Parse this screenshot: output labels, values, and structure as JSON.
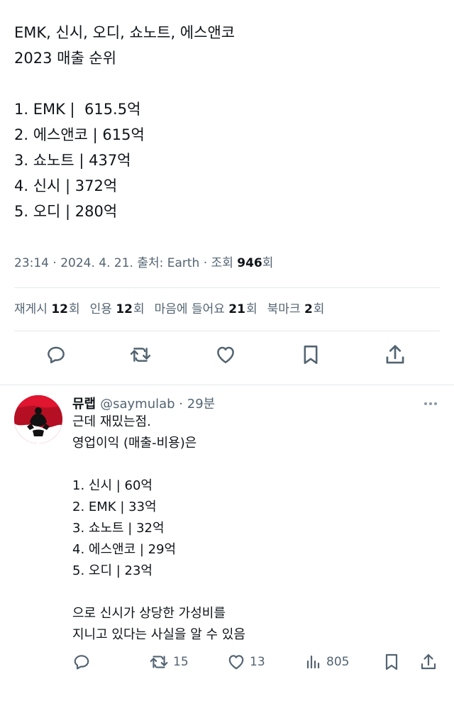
{
  "tweet": {
    "lines": [
      "EMK, 신시, 오디, 쇼노트, 에스앤코",
      "2023 매출 순위",
      "",
      "1. EMK |  615.5억",
      "2. 에스앤코 | 615억",
      "3. 쇼노트 | 437억",
      "4. 신시 | 372억",
      "5. 오디 | 280억"
    ],
    "meta_prefix": "23:14 · 2024. 4. 21. 출처: Earth · 조회 ",
    "views_count": "946",
    "views_suffix": "회",
    "stats": [
      {
        "label": "재게시",
        "count": "12",
        "suffix": "회"
      },
      {
        "label": "인용",
        "count": "12",
        "suffix": "회"
      },
      {
        "label": "마음에 들어요",
        "count": "21",
        "suffix": "회"
      },
      {
        "label": "북마크",
        "count": "2",
        "suffix": "회"
      }
    ],
    "actions": [
      {
        "icon": "reply-icon"
      },
      {
        "icon": "retweet-icon"
      },
      {
        "icon": "heart-icon"
      },
      {
        "icon": "bookmark-icon"
      },
      {
        "icon": "share-icon"
      }
    ]
  },
  "reply": {
    "name": "뮤랩",
    "handle": "@saymulab · 29분",
    "lines": [
      "근데 재밌는점.",
      "영업이익 (매출-비용)은",
      "",
      "1. 신시 | 60억",
      "2. EMK | 33억",
      "3. 쇼노트 | 32억",
      "4. 에스앤코 | 29억",
      "5. 오디 | 23억",
      "",
      "으로 신시가 상당한 가성비를",
      "지니고 있다는 사실을 알 수 있음"
    ],
    "retweets": "15",
    "likes": "13",
    "views": "805"
  },
  "colors": {
    "text": "#0f1419",
    "secondary": "#536471",
    "divider": "#e4e7ea",
    "avatar_red": "#c8102e"
  }
}
